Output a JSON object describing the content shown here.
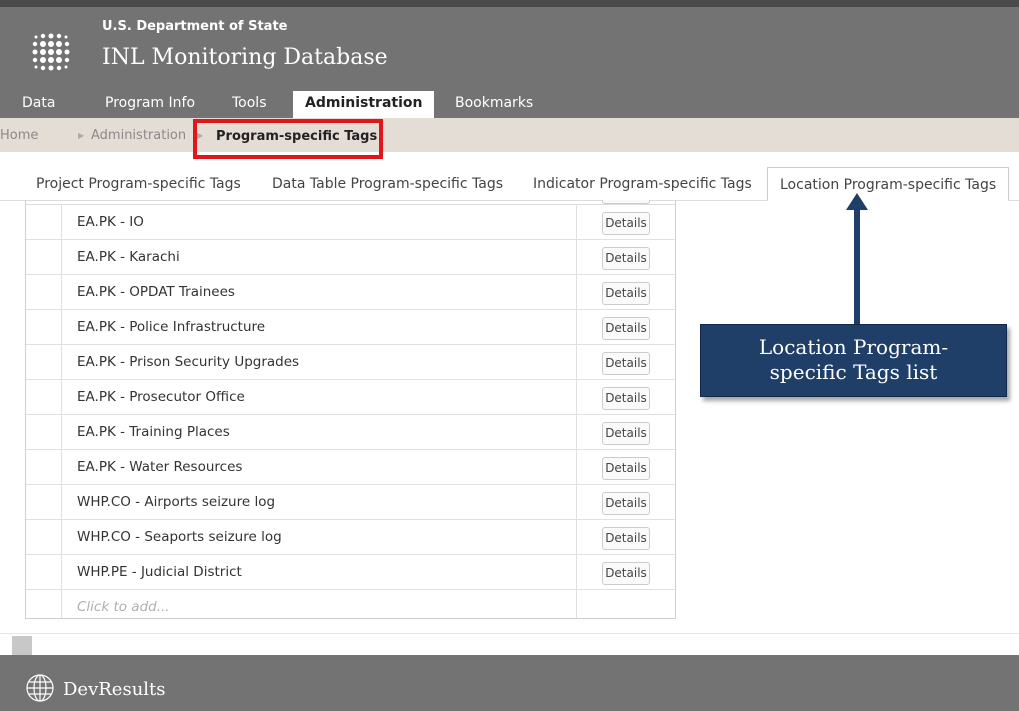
{
  "header": {
    "organization": "U.S. Department of State",
    "app_title": "INL Monitoring Database"
  },
  "nav": {
    "tabs": [
      {
        "label": "Data"
      },
      {
        "label": "Program Info"
      },
      {
        "label": "Tools"
      },
      {
        "label": "Administration",
        "active": true
      },
      {
        "label": "Bookmarks"
      }
    ]
  },
  "breadcrumb": {
    "items": [
      "Home",
      "Administration"
    ],
    "current": "Program-specific Tags"
  },
  "subtabs": [
    {
      "label": "Project Program-specific Tags"
    },
    {
      "label": "Data Table Program-specific Tags"
    },
    {
      "label": "Indicator Program-specific Tags"
    },
    {
      "label": "Location Program-specific Tags",
      "active": true
    }
  ],
  "table": {
    "rows": [
      {
        "name": "EA.PK - IO",
        "action": "Details"
      },
      {
        "name": "EA.PK - Karachi",
        "action": "Details"
      },
      {
        "name": "EA.PK - OPDAT Trainees",
        "action": "Details"
      },
      {
        "name": "EA.PK - Police Infrastructure",
        "action": "Details"
      },
      {
        "name": "EA.PK - Prison Security Upgrades",
        "action": "Details"
      },
      {
        "name": "EA.PK - Prosecutor Office",
        "action": "Details"
      },
      {
        "name": "EA.PK - Training Places",
        "action": "Details"
      },
      {
        "name": "EA.PK - Water Resources",
        "action": "Details"
      },
      {
        "name": "WHP.CO - Airports seizure log",
        "action": "Details"
      },
      {
        "name": "WHP.CO - Seaports seizure log",
        "action": "Details"
      },
      {
        "name": "WHP.PE - Judicial District",
        "action": "Details"
      }
    ],
    "add_placeholder": "Click to add..."
  },
  "callout": {
    "line1": "Location Program-",
    "line2": "specific Tags list"
  },
  "footer": {
    "brand": "DevResults"
  },
  "colors": {
    "header_bg": "#737373",
    "breadcrumb_bg": "#e4ddd5",
    "highlight_red": "#e0161a",
    "callout_navy": "#1f3e68"
  }
}
